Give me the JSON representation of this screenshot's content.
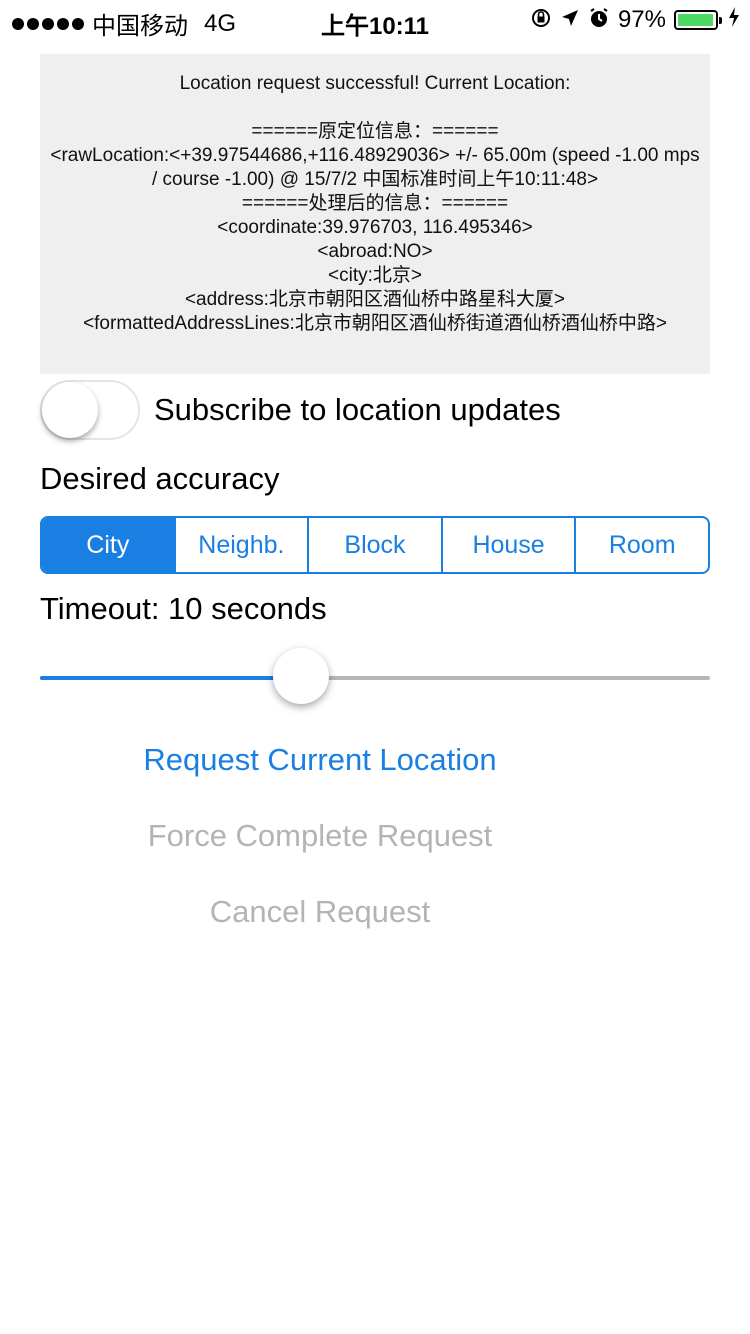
{
  "status_bar": {
    "signal_bars": 5,
    "carrier": "中国移动",
    "network": "4G",
    "time": "上午10:11",
    "battery_percent": "97%",
    "battery_level": 0.97,
    "icons": [
      "orientation-lock-icon",
      "location-arrow-icon",
      "alarm-icon",
      "battery-icon",
      "charging-bolt-icon"
    ]
  },
  "log": {
    "lines": [
      "Location request successful! Current Location:",
      "",
      "======原定位信息：======",
      "<rawLocation:<+39.97544686,+116.48929036> +/- 65.00m (speed -1.00 mps / course -1.00) @ 15/7/2 中国标准时间上午10:11:48>",
      "======处理后的信息：======",
      "<coordinate:39.976703, 116.495346>",
      "<abroad:NO>",
      "<city:北京>",
      "<address:北京市朝阳区酒仙桥中路星科大厦>",
      "<formattedAddressLines:北京市朝阳区酒仙桥街道酒仙桥酒仙桥中路>"
    ]
  },
  "subscribe": {
    "label": "Subscribe to location updates",
    "on": false
  },
  "accuracy": {
    "label": "Desired accuracy",
    "options": [
      "City",
      "Neighb.",
      "Block",
      "House",
      "Room"
    ],
    "selected_index": 0
  },
  "timeout": {
    "label": "Timeout: 10 seconds",
    "slider_fraction": 0.39
  },
  "buttons": {
    "request": "Request Current Location",
    "force": "Force Complete Request",
    "cancel": "Cancel Request"
  },
  "colors": {
    "accent": "#1a7fe3",
    "disabled": "#b4b4b4",
    "log_background": "#efefef",
    "battery_green": "#4cd964"
  }
}
